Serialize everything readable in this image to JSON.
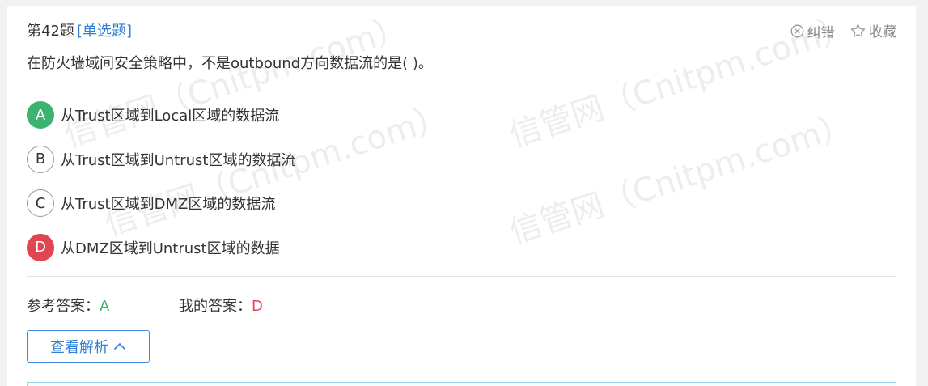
{
  "question": {
    "number_label": "第42题",
    "type_label": "[单选题]",
    "text": "在防火墙域间安全策略中，不是outbound方向数据流的是( )。"
  },
  "actions": {
    "report_label": "纠错",
    "favorite_label": "收藏"
  },
  "options": [
    {
      "letter": "A",
      "text": "从Trust区域到Local区域的数据流",
      "state": "correct"
    },
    {
      "letter": "B",
      "text": "从Trust区域到Untrust区域的数据流",
      "state": "normal"
    },
    {
      "letter": "C",
      "text": "从Trust区域到DMZ区域的数据流",
      "state": "normal"
    },
    {
      "letter": "D",
      "text": "从DMZ区域到Untrust区域的数据",
      "state": "wrong"
    }
  ],
  "answers": {
    "reference_label": "参考答案：",
    "reference_value": "A",
    "mine_label": "我的答案：",
    "mine_value": "D"
  },
  "analysis_button_label": "查看解析",
  "watermark_text": "信管网（Cnitpm.com）",
  "colors": {
    "accent": "#2f7fd6",
    "correct": "#3cb371",
    "wrong": "#e04552"
  }
}
